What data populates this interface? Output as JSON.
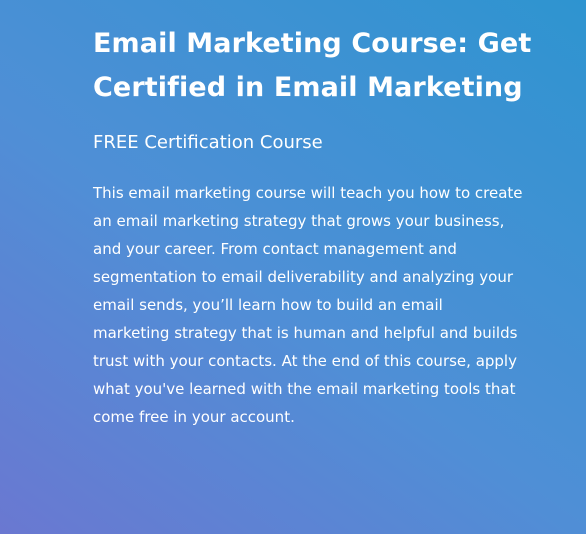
{
  "hero": {
    "title": "Email Marketing Course: Get Certified in Email Marketing",
    "subtitle": "FREE Certification Course",
    "description": "This email marketing course will teach you how to create an email marketing strategy that grows your business, and your career. From contact management and segmentation to email deliverability and analyzing your email sends, you’ll learn how to build an email marketing strategy that is human and helpful and builds trust with your contacts. At the end of this course, apply what you've learned with the email marketing tools that come free in your account."
  },
  "colors": {
    "gradient_start": "#6a78d1",
    "gradient_end": "#2e94d0",
    "text": "#ffffff"
  }
}
